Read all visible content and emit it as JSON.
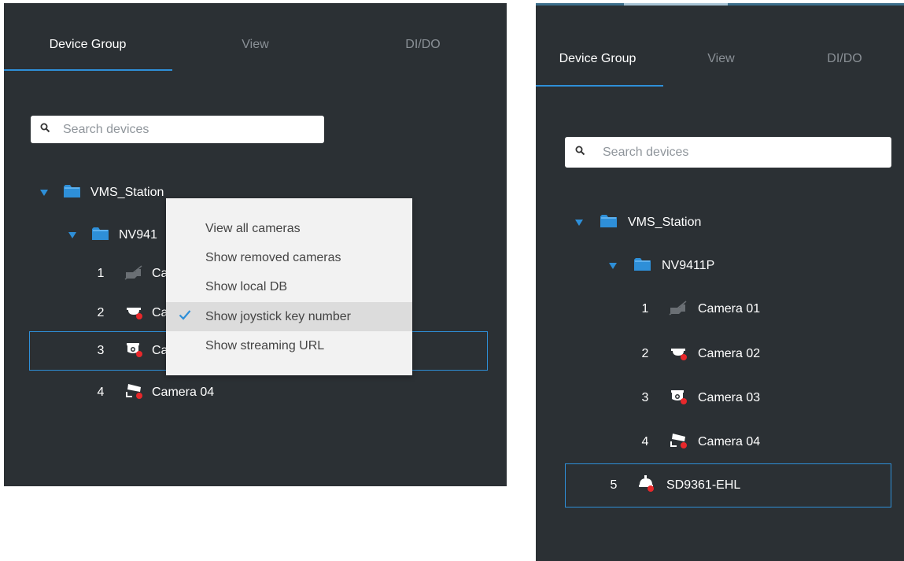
{
  "left_panel": {
    "tabs": [
      {
        "label": "Device Group"
      },
      {
        "label": "View"
      },
      {
        "label": "DI/DO"
      }
    ],
    "search": {
      "placeholder": "Search devices"
    },
    "tree": {
      "root": "VMS_Station",
      "nvr": "NV941",
      "cameras": [
        {
          "num": "1",
          "name": "Ca"
        },
        {
          "num": "2",
          "name": "Ca"
        },
        {
          "num": "3",
          "name": "Ca"
        },
        {
          "num": "4",
          "name": "Camera 04"
        }
      ]
    },
    "context_menu": {
      "items": [
        {
          "label": "View all cameras"
        },
        {
          "label": "Show removed cameras"
        },
        {
          "label": "Show local DB"
        },
        {
          "label": "Show joystick key number",
          "checked": true
        },
        {
          "label": "Show streaming URL"
        }
      ]
    }
  },
  "right_panel": {
    "tabs": [
      {
        "label": "Device Group"
      },
      {
        "label": "View"
      },
      {
        "label": "DI/DO"
      }
    ],
    "search": {
      "placeholder": "Search devices"
    },
    "tree": {
      "root": "VMS_Station",
      "nvr": "NV9411P",
      "cameras": [
        {
          "num": "1",
          "name": "Camera 01"
        },
        {
          "num": "2",
          "name": "Camera 02"
        },
        {
          "num": "3",
          "name": "Camera 03"
        },
        {
          "num": "4",
          "name": "Camera 04"
        }
      ],
      "device": {
        "num": "5",
        "name": "SD9361-EHL"
      }
    }
  },
  "colors": {
    "panel_bg": "#2b3034",
    "accent": "#2e8fd8",
    "tab_inactive": "#8a9096",
    "status_dot": "#e8282b",
    "menu_bg": "#f2f2f2",
    "menu_highlight": "#dcdcdc"
  },
  "icons": [
    "search-icon",
    "folder-icon",
    "camera-disabled-icon",
    "dome-camera-icon",
    "fisheye-camera-icon",
    "bullet-camera-icon",
    "speed-dome-icon",
    "checkmark-icon"
  ]
}
